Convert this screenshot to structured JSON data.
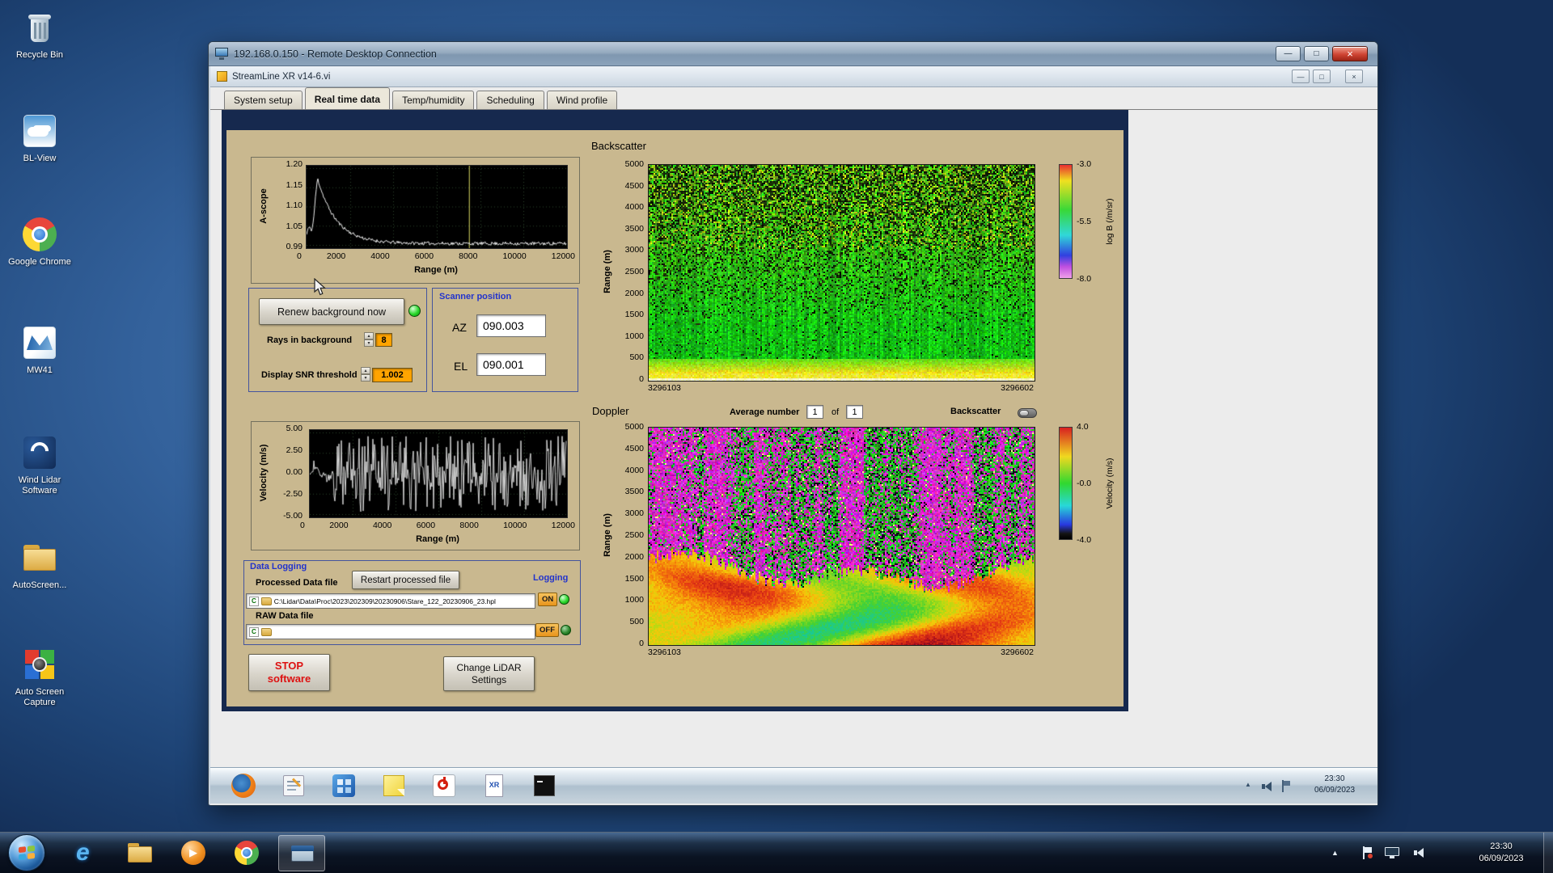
{
  "desktop": {
    "icons": [
      {
        "label": "Recycle Bin"
      },
      {
        "label": "BL-View"
      },
      {
        "label": "Google Chrome"
      },
      {
        "label": "MW41"
      },
      {
        "label": "Wind Lidar Software"
      },
      {
        "label": "AutoScreen..."
      },
      {
        "label": "Auto Screen Capture"
      }
    ]
  },
  "glyphs": {
    "up": "▴",
    "down": "▾",
    "tray": "▲",
    "play": "▶"
  },
  "rdp": {
    "title": "192.168.0.150 - Remote Desktop Connection",
    "minimize": "—",
    "maximize": "□",
    "close": "×"
  },
  "app": {
    "title": "StreamLine XR v14-6.vi",
    "minimize": "—",
    "maximize": "□",
    "close": "×",
    "tabs": [
      {
        "label": "System setup"
      },
      {
        "label": "Real time data"
      },
      {
        "label": "Temp/humidity"
      },
      {
        "label": "Scheduling"
      },
      {
        "label": "Wind profile"
      }
    ]
  },
  "ascope": {
    "y_label": "A-scope",
    "x_label": "Range (m)",
    "y_ticks": [
      "1.20",
      "1.15",
      "1.10",
      "1.05",
      "0.99"
    ],
    "x_ticks": [
      "0",
      "2000",
      "4000",
      "6000",
      "8000",
      "10000",
      "12000"
    ]
  },
  "background_ctrl": {
    "renew_button": "Renew background now",
    "rays_label": "Rays in background",
    "rays_value": "8",
    "snr_label": "Display SNR threshold",
    "snr_value": "1.002"
  },
  "scanner": {
    "title": "Scanner position",
    "az_label": "AZ",
    "az_value": "090.003",
    "el_label": "EL",
    "el_value": "090.001"
  },
  "velocity": {
    "y_label": "Velocity (m/s)",
    "x_label": "Range (m)",
    "y_ticks": [
      "5.00",
      "2.50",
      "0.00",
      "-2.50",
      "-5.00"
    ],
    "x_ticks": [
      "0",
      "2000",
      "4000",
      "6000",
      "8000",
      "10000",
      "12000"
    ]
  },
  "datalog": {
    "title": "Data Logging",
    "processed_label": "Processed Data file",
    "restart_button": "Restart processed file",
    "logging_label": "Logging",
    "drive": "C",
    "processed_path": "C:\\Lidar\\Data\\Proc\\2023\\202309\\20230906\\Stare_122_20230906_23.hpl",
    "on_label": "ON",
    "raw_label": "RAW Data file",
    "raw_path": "",
    "off_label": "OFF"
  },
  "actions": {
    "stop_line1": "STOP",
    "stop_line2": "software",
    "change_line1": "Change LiDAR",
    "change_line2": "Settings"
  },
  "backscatter": {
    "title": "Backscatter",
    "y_label": "Range (m)",
    "y_ticks": [
      "5000",
      "4500",
      "4000",
      "3500",
      "3000",
      "2500",
      "2000",
      "1500",
      "1000",
      "500",
      "0"
    ],
    "x_start": "3296103",
    "x_end": "3296602",
    "cb_label": "log B (/m/sr)",
    "cb_ticks": [
      "-3.0",
      "-5.5",
      "-8.0"
    ]
  },
  "doppler": {
    "title": "Doppler",
    "avg_label": "Average number",
    "avg_value": "1",
    "of_label": "of",
    "count_value": "1",
    "toggle_label": "Backscatter",
    "y_label": "Range (m)",
    "y_ticks": [
      "5000",
      "4500",
      "4000",
      "3500",
      "3000",
      "2500",
      "2000",
      "1500",
      "1000",
      "500",
      "0"
    ],
    "x_start": "3296103",
    "x_end": "3296602",
    "cb_label": "Velocity (m/s)",
    "cb_ticks": [
      "4.0",
      "-0.0",
      "-4.0"
    ]
  },
  "inner_taskbar": {
    "time": "23:30",
    "date": "06/09/2023",
    "xr_badge": "XR"
  },
  "taskbar": {
    "time": "23:30",
    "date": "06/09/2023",
    "ie": "e"
  },
  "colors": {
    "panel_tan": "#c9b88f",
    "frame_navy": "#16294e",
    "accent_blue": "#2233cc",
    "field_orange": "#ffa400",
    "led_green": "#2bd82b",
    "stop_red": "#dd1111"
  }
}
